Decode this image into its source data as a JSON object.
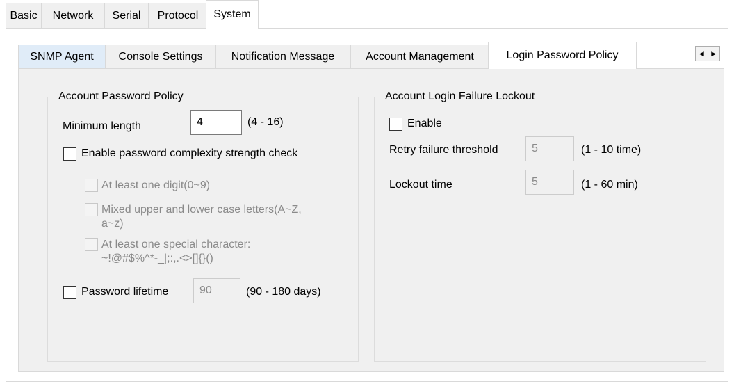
{
  "top_tabs": [
    {
      "label": "Basic"
    },
    {
      "label": "Network"
    },
    {
      "label": "Serial"
    },
    {
      "label": "Protocol"
    },
    {
      "label": "System",
      "active": true
    }
  ],
  "sub_tabs": [
    {
      "label": "SNMP Agent"
    },
    {
      "label": "Console Settings"
    },
    {
      "label": "Notification Message"
    },
    {
      "label": "Account Management"
    },
    {
      "label": "Login Password Policy",
      "active": true
    }
  ],
  "tab_scroll": {
    "left_icon": "arrow-left-icon",
    "right_icon": "arrow-right-icon",
    "left_glyph": "◀",
    "right_glyph": "▶"
  },
  "password_policy": {
    "title": "Account Password Policy",
    "min_length_label": "Minimum length",
    "min_length_value": "4",
    "min_length_range": "(4 - 16)",
    "complexity_label": "Enable password complexity strength check",
    "complexity_checked": false,
    "digit_label": "At least one digit(0~9)",
    "mixed_case_label_line1": "Mixed upper and lower case letters(A~Z,",
    "mixed_case_label_line2": "a~z)",
    "special_label_line1": "At least one special character:",
    "special_label_line2": "~!@#$%^*-_|;:,.<>[]{}()",
    "lifetime_label": "Password lifetime",
    "lifetime_value": "90",
    "lifetime_range": "(90 - 180 days)",
    "lifetime_checked": false
  },
  "lockout": {
    "title": "Account Login Failure Lockout",
    "enable_label": "Enable",
    "enable_checked": false,
    "retry_label": "Retry failure threshold",
    "retry_value": "5",
    "retry_range": "(1 - 10 time)",
    "lockout_label": "Lockout time",
    "lockout_value": "5",
    "lockout_range": "(1 - 60 min)"
  }
}
